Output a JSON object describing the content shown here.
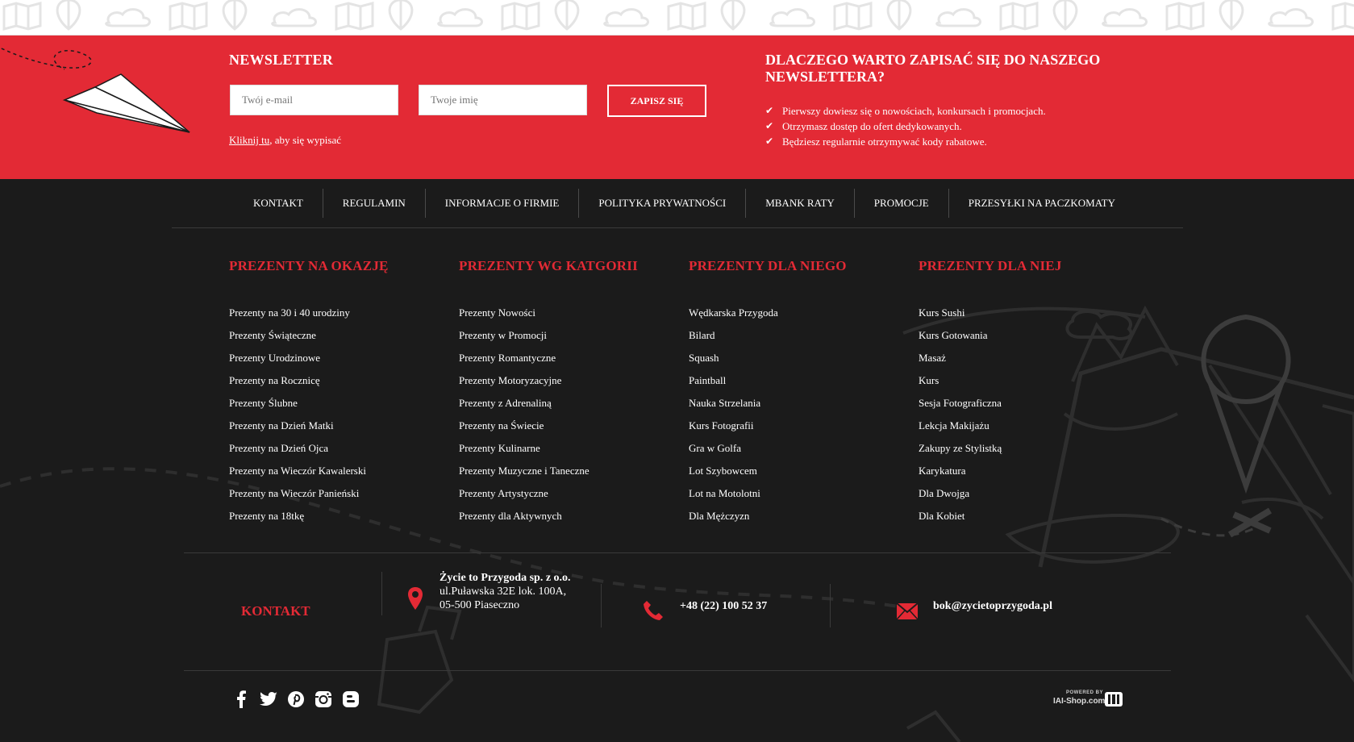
{
  "colors": {
    "accent": "#e32a35",
    "footer_bg": "#1b1b1b",
    "text": "#ffffff"
  },
  "newsletter": {
    "title": "NEWSLETTER",
    "email_placeholder": "Twój e-mail",
    "name_placeholder": "Twoje imię",
    "submit_label": "ZAPISZ SIĘ",
    "unsubscribe_link": "Kliknij tu",
    "unsubscribe_rest": ", aby się wypisać",
    "why_title": "DLACZEGO WARTO ZAPISAĆ SIĘ DO NASZEGO NEWSLETTERA?",
    "benefits": [
      "Pierwszy dowiesz się o nowościach, konkursach i promocjach.",
      "Otrzymasz dostęp do ofert dedykowanych.",
      "Będziesz regularnie otrzymywać kody rabatowe."
    ]
  },
  "nav": {
    "items": [
      "KONTAKT",
      "REGULAMIN",
      "INFORMACJE O FIRMIE",
      "POLITYKA PRYWATNOŚCI",
      "MBANK RATY",
      "PROMOCJE",
      "PRZESYŁKI NA PACZKOMATY"
    ]
  },
  "columns": [
    {
      "title": "PREZENTY NA OKAZJĘ",
      "items": [
        "Prezenty na 30 i 40 urodziny",
        "Prezenty Świąteczne",
        "Prezenty Urodzinowe",
        "Prezenty na Rocznicę",
        "Prezenty Ślubne",
        "Prezenty na Dzień Matki",
        "Prezenty na Dzień Ojca",
        "Prezenty na Wieczór Kawalerski",
        "Prezenty na Wieczór Panieński",
        "Prezenty na 18tkę"
      ]
    },
    {
      "title": "PREZENTY WG KATGORII",
      "items": [
        "Prezenty Nowości",
        "Prezenty w Promocji",
        "Prezenty Romantyczne",
        "Prezenty Motoryzacyjne",
        "Prezenty z Adrenaliną",
        "Prezenty na Świecie",
        "Prezenty Kulinarne",
        "Prezenty Muzyczne i Taneczne",
        "Prezenty Artystyczne",
        "Prezenty dla Aktywnych"
      ]
    },
    {
      "title": "PREZENTY DLA NIEGO",
      "items": [
        "Wędkarska Przygoda",
        "Bilard",
        "Squash",
        "Paintball",
        "Nauka Strzelania",
        "Kurs Fotografii",
        "Gra w Golfa",
        "Lot Szybowcem",
        "Lot na Motolotni",
        "Dla Mężczyzn"
      ]
    },
    {
      "title": "PREZENTY DLA NIEJ",
      "items": [
        "Kurs Sushi",
        "Kurs Gotowania",
        "Masaż",
        "Kurs",
        "Sesja Fotograficzna",
        "Lekcja Makijażu",
        "Zakupy ze Stylistką",
        "Karykatura",
        "Dla Dwojga",
        "Dla Kobiet"
      ]
    }
  ],
  "contact": {
    "label": "KONTAKT",
    "company": "Życie to Przygoda sp. z o.o.",
    "street": "ul.Puławska 32E lok. 100A,",
    "city": "05-500 Piaseczno",
    "phone": "+48 (22) 100 52 37",
    "email": "bok@zycietoprzygoda.pl"
  },
  "social": [
    "facebook-icon",
    "twitter-icon",
    "pinterest-icon",
    "instagram-icon",
    "blogger-icon"
  ],
  "powered": {
    "small": "POWERED BY",
    "big": "IAI-Shop.com"
  }
}
